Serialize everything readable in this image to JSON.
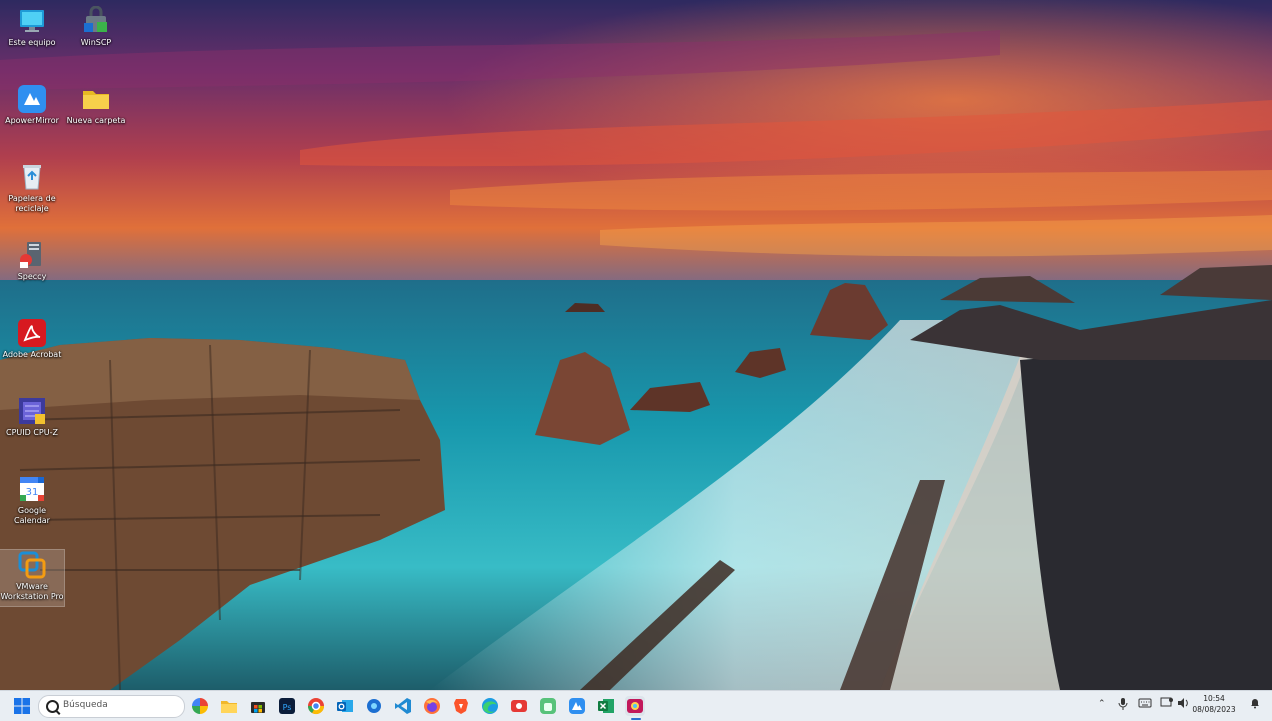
{
  "desktop": {
    "icons": [
      {
        "label": "Este equipo",
        "icon": "monitor-icon"
      },
      {
        "label": "WinSCP",
        "icon": "winscp-icon"
      },
      {
        "label": "ApowerMirror",
        "icon": "apowermirror-icon"
      },
      {
        "label": "Nueva carpeta",
        "icon": "folder-icon"
      },
      {
        "label": "Papelera de reciclaje",
        "icon": "recycle-bin-icon"
      },
      {
        "label": "Speccy",
        "icon": "speccy-icon"
      },
      {
        "label": "Adobe Acrobat",
        "icon": "adobe-acrobat-icon"
      },
      {
        "label": "CPUID CPU-Z",
        "icon": "cpu-z-icon"
      },
      {
        "label": "Google Calendar",
        "icon": "google-calendar-icon"
      },
      {
        "label": "VMware Workstation Pro",
        "icon": "vmware-icon"
      }
    ]
  },
  "taskbar": {
    "search_placeholder": "Búsqueda",
    "apps": [
      "start-icon",
      "pinwheel-icon",
      "file-explorer-icon",
      "microsoft-store-icon",
      "photoshop-icon",
      "chrome-icon",
      "outlook-icon",
      "copilot-icon",
      "vscode-icon",
      "firefox-icon",
      "brave-icon",
      "edge-icon",
      "recorder-icon",
      "android-icon",
      "apowermirror-icon",
      "excel-icon",
      "gradient-app-icon"
    ],
    "tray": {
      "time": "10:54",
      "date": "08/08/2023"
    }
  }
}
